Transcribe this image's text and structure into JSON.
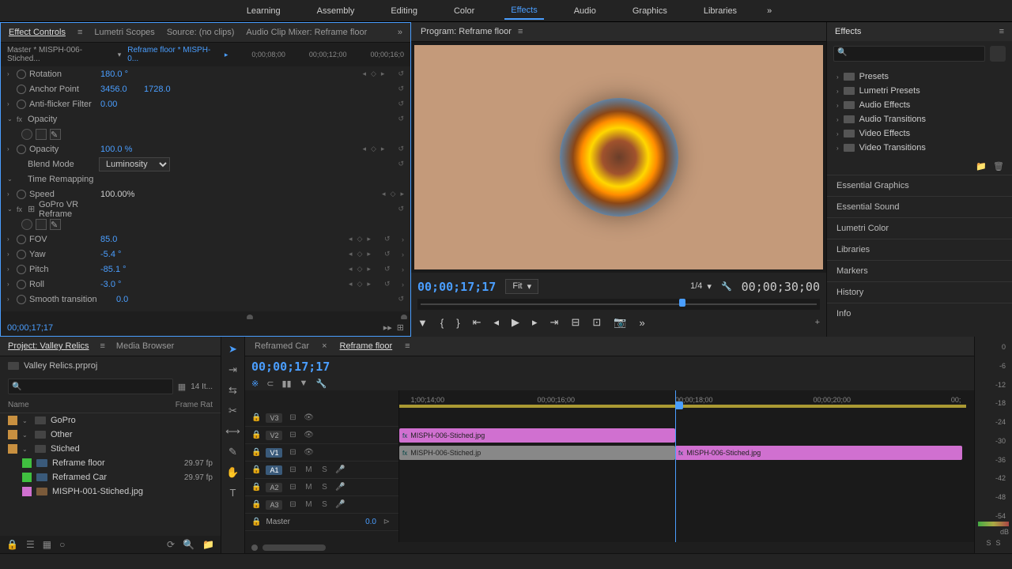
{
  "topbar": {
    "items": [
      "Learning",
      "Assembly",
      "Editing",
      "Color",
      "Effects",
      "Audio",
      "Graphics",
      "Libraries"
    ],
    "active": "Effects"
  },
  "effectControls": {
    "tabs": [
      "Effect Controls",
      "Lumetri Scopes",
      "Source: (no clips)",
      "Audio Clip Mixer: Reframe floor"
    ],
    "activeTab": "Effect Controls",
    "masterClip": "Master * MISPH-006-Stiched...",
    "sequenceClip": "Reframe floor * MISPH-0...",
    "timelineTicks": [
      "0;00;08;00",
      "00;00;12;00",
      "00;00;16;0"
    ],
    "rows": {
      "rotation": {
        "label": "Rotation",
        "value": "180.0 °"
      },
      "anchor": {
        "label": "Anchor Point",
        "x": "3456.0",
        "y": "1728.0"
      },
      "antiflicker": {
        "label": "Anti-flicker Filter",
        "value": "0.00"
      },
      "opacityHeader": {
        "label": "Opacity"
      },
      "opacity": {
        "label": "Opacity",
        "value": "100.0 %"
      },
      "blendMode": {
        "label": "Blend Mode",
        "value": "Luminosity"
      },
      "timeRemap": {
        "label": "Time Remapping"
      },
      "speed": {
        "label": "Speed",
        "value": "100.00%"
      },
      "vrReframe": {
        "label": "GoPro VR Reframe"
      },
      "fov": {
        "label": "FOV",
        "value": "85.0"
      },
      "yaw": {
        "label": "Yaw",
        "value": "-5.4 °"
      },
      "pitch": {
        "label": "Pitch",
        "value": "-85.1 °"
      },
      "roll": {
        "label": "Roll",
        "value": "-3.0 °"
      },
      "smooth": {
        "label": "Smooth transition",
        "value": "0.0"
      }
    },
    "footer_tc": "00;00;17;17"
  },
  "program": {
    "title": "Program: Reframe floor",
    "tc": "00;00;17;17",
    "fit": "Fit",
    "resolution": "1/4",
    "duration": "00;00;30;00"
  },
  "effectsPanel": {
    "title": "Effects",
    "searchPlaceholder": "",
    "tree": [
      "Presets",
      "Lumetri Presets",
      "Audio Effects",
      "Audio Transitions",
      "Video Effects",
      "Video Transitions"
    ],
    "sections": [
      "Essential Graphics",
      "Essential Sound",
      "Lumetri Color",
      "Libraries",
      "Markers",
      "History",
      "Info"
    ]
  },
  "project": {
    "tabs": [
      "Project: Valley Relics",
      "Media Browser"
    ],
    "activeTab": "Project: Valley Relics",
    "file": "Valley Relics.prproj",
    "itemCount": "14 It...",
    "columns": [
      "Name",
      "Frame Rat"
    ],
    "items": [
      {
        "swatch": "#c89040",
        "type": "folder",
        "name": "GoPro",
        "fr": ""
      },
      {
        "swatch": "#c89040",
        "type": "folder",
        "name": "Other",
        "fr": ""
      },
      {
        "swatch": "#c89040",
        "type": "folder",
        "name": "Stiched",
        "fr": "",
        "expanded": true
      },
      {
        "swatch": "#40c040",
        "type": "seq",
        "name": "Reframe floor",
        "fr": "29.97 fp",
        "indent": true
      },
      {
        "swatch": "#40c040",
        "type": "seq",
        "name": "Reframed Car",
        "fr": "29.97 fp",
        "indent": true
      },
      {
        "swatch": "#d070d0",
        "type": "img",
        "name": "MISPH-001-Stiched.jpg",
        "fr": "",
        "indent": true
      }
    ]
  },
  "timeline": {
    "tabs": [
      "Reframed Car",
      "Reframe floor"
    ],
    "activeTab": "Reframe floor",
    "tc": "00;00;17;17",
    "ruler": [
      "1;00;14;00",
      "00;00;16;00",
      "00;00;18;00",
      "00;00;20;00",
      "00;"
    ],
    "tracks": {
      "v3": {
        "name": "V3"
      },
      "v2": {
        "name": "V2"
      },
      "v1": {
        "name": "V1",
        "active": true
      },
      "a1": {
        "name": "A1",
        "active": true
      },
      "a2": {
        "name": "A2"
      },
      "a3": {
        "name": "A3"
      },
      "master": {
        "name": "Master",
        "value": "0.0"
      }
    },
    "clips": {
      "v2": {
        "name": "MISPH-006-Stiched.jpg"
      },
      "v1a": {
        "name": "MISPH-006-Stiched.jp"
      },
      "v1b": {
        "name": "MISPH-006-Stiched.jpg"
      }
    }
  },
  "audioMeter": {
    "scale": [
      "0",
      "-6",
      "-12",
      "-18",
      "-24",
      "-30",
      "-36",
      "-42",
      "-48",
      "-54",
      "dB"
    ],
    "solo": [
      "S",
      "S"
    ]
  }
}
